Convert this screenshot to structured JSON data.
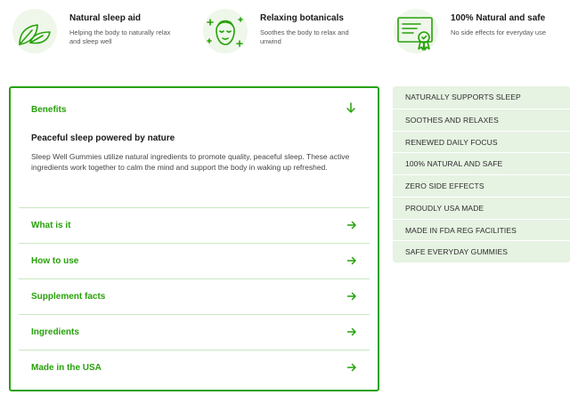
{
  "features": [
    {
      "icon": "leaf-icon",
      "title": "Natural sleep aid",
      "desc": "Helping the body to naturally relax and sleep well"
    },
    {
      "icon": "relaxed-face-icon",
      "title": "Relaxing botanicals",
      "desc": "Soothes the body to relax and unwind"
    },
    {
      "icon": "certificate-icon",
      "title": "100% Natural and safe",
      "desc": "No side effects for everyday use"
    }
  ],
  "accordion": {
    "open": {
      "label": "Benefits",
      "subtitle": "Peaceful sleep powered by nature",
      "body": "Sleep Well Gummies utilize natural ingredients to promote quality, peaceful sleep. These active ingredients work together to calm the mind and support the body in waking up refreshed."
    },
    "items": [
      {
        "label": "What is it"
      },
      {
        "label": "How to use"
      },
      {
        "label": "Supplement facts"
      },
      {
        "label": "Ingredients"
      },
      {
        "label": "Made in the USA"
      }
    ]
  },
  "tags": [
    "NATURALLY SUPPORTS SLEEP",
    "SOOTHES AND RELAXES",
    "RENEWED DAILY FOCUS",
    "100% NATURAL AND SAFE",
    "ZERO SIDE EFFECTS",
    "PROUDLY USA MADE",
    "MADE IN FDA REG FACILITIES",
    "SAFE EVERYDAY GUMMIES"
  ],
  "colors": {
    "accent": "#27a10a",
    "tag_bg": "#e6f2e2",
    "divider": "#c9e7c1"
  }
}
